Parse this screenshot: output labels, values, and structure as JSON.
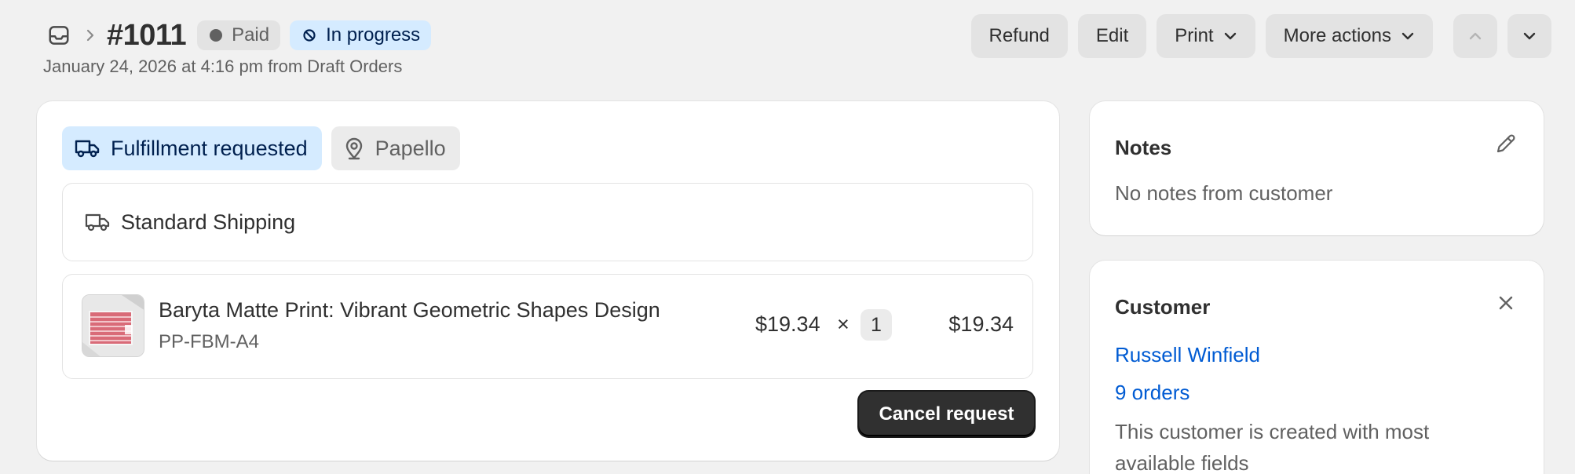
{
  "header": {
    "order_number": "#1011",
    "payment_status": "Paid",
    "fulfillment_status": "In progress",
    "subtitle": "January 24, 2026 at 4:16 pm from Draft Orders",
    "actions": {
      "refund": "Refund",
      "edit": "Edit",
      "print": "Print",
      "more": "More actions"
    },
    "icons": {
      "back": "inbox-icon",
      "breadcrumb_sep": "chevron-right-icon",
      "prev": "chevron-up-icon",
      "next": "chevron-down-icon"
    }
  },
  "fulfillment": {
    "status_tag": "Fulfillment requested",
    "location_tag": "Papello",
    "shipping_method": "Standard Shipping",
    "line_item": {
      "name": "Baryta Matte Print: Vibrant Geometric Shapes Design",
      "sku": "PP-FBM-A4",
      "unit_price": "$19.34",
      "times": "×",
      "quantity": "1",
      "total": "$19.34"
    },
    "cancel_label": "Cancel request"
  },
  "notes": {
    "title": "Notes",
    "text": "No notes from customer"
  },
  "customer": {
    "title": "Customer",
    "name": "Russell Winfield",
    "orders": "9 orders",
    "note": "This customer is created with most available fields"
  },
  "colors": {
    "background": "#f1f1f1",
    "info_bg": "#d5ebff",
    "info_text": "#00204f",
    "link": "#005bd3",
    "primary_button": "#303030"
  }
}
